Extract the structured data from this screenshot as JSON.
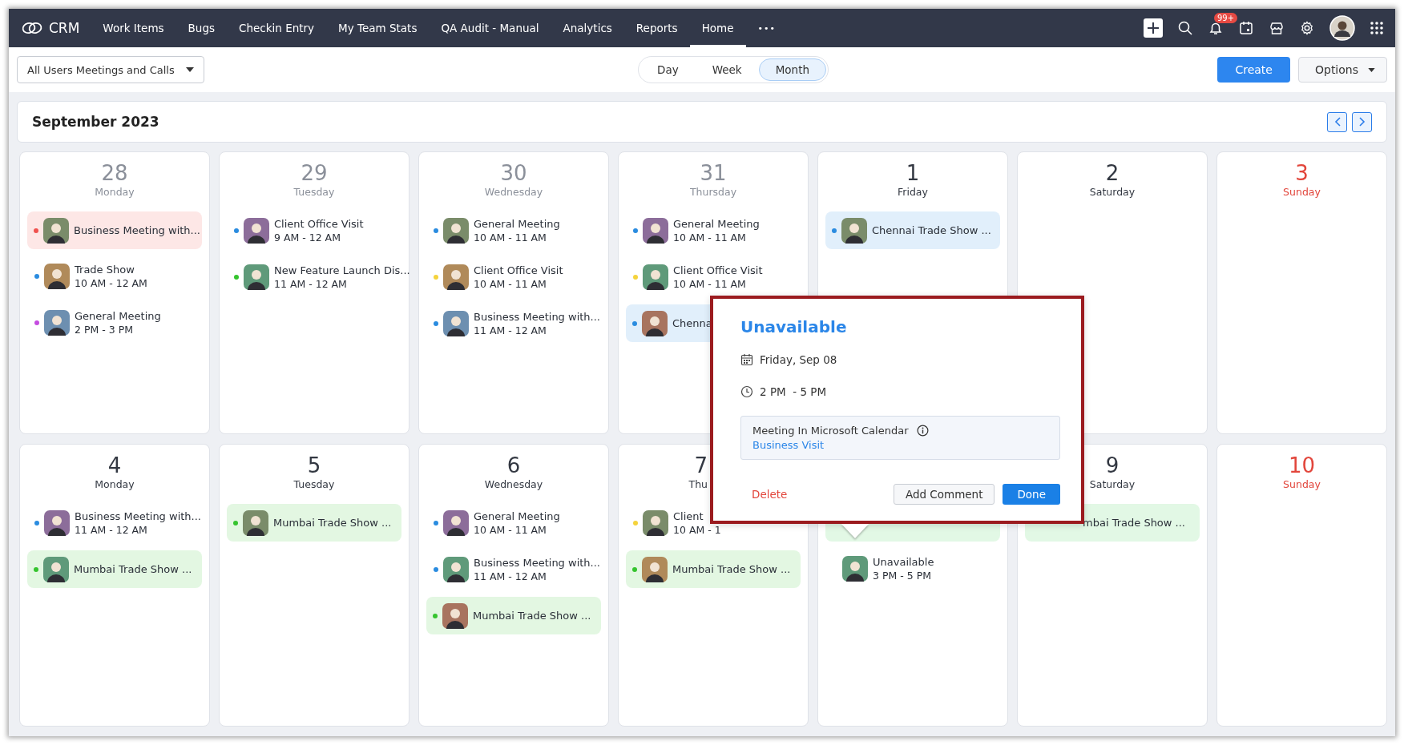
{
  "nav": {
    "brand": "CRM",
    "items": [
      {
        "label": "Work Items",
        "selected": false
      },
      {
        "label": "Bugs",
        "selected": false
      },
      {
        "label": "Checkin Entry",
        "selected": false
      },
      {
        "label": "My Team Stats",
        "selected": false
      },
      {
        "label": "QA Audit - Manual",
        "selected": false
      },
      {
        "label": "Analytics",
        "selected": false
      },
      {
        "label": "Reports",
        "selected": false
      },
      {
        "label": "Home",
        "selected": true
      }
    ],
    "more": "•••",
    "notification_badge": "99+"
  },
  "toolbar": {
    "view_select": "All Users Meetings and Calls",
    "views": [
      {
        "label": "Day",
        "selected": false
      },
      {
        "label": "Week",
        "selected": false
      },
      {
        "label": "Month",
        "selected": true
      }
    ],
    "create": "Create",
    "options": "Options"
  },
  "calendar": {
    "title": "September 2023",
    "days": [
      {
        "number": "28",
        "weekday": "Monday",
        "kind": "past_month",
        "events": [
          {
            "kind": "allday",
            "title": "Business Meeting with...",
            "color": "#f0524f"
          },
          {
            "kind": "timed",
            "title": "Trade Show",
            "time": "10 AM - 12 AM",
            "color": "#2a8ce0"
          },
          {
            "kind": "timed",
            "title": "General Meeting",
            "time": "2 PM - 3 PM",
            "color": "#c54ce0"
          }
        ]
      },
      {
        "number": "29",
        "weekday": "Tuesday",
        "kind": "past_month",
        "events": [
          {
            "kind": "timed",
            "title": "Client Office Visit",
            "time": "9 AM - 12 AM",
            "color": "#2a8ce0"
          },
          {
            "kind": "timed",
            "title": "New Feature Launch Dis...",
            "time": "11 AM - 12 AM",
            "color": "#35c42e"
          }
        ]
      },
      {
        "number": "30",
        "weekday": "Wednesday",
        "kind": "past_month",
        "events": [
          {
            "kind": "timed",
            "title": "General Meeting",
            "time": "10 AM - 11 AM",
            "color": "#2a8ce0"
          },
          {
            "kind": "timed",
            "title": "Client Office Visit",
            "time": "10 AM - 11 AM",
            "color": "#f5d33c"
          },
          {
            "kind": "timed",
            "title": "Business Meeting with...",
            "time": "11 AM - 12 AM",
            "color": "#2a8ce0"
          }
        ]
      },
      {
        "number": "31",
        "weekday": "Thursday",
        "kind": "past_month",
        "events": [
          {
            "kind": "timed",
            "title": "General Meeting",
            "time": "10 AM - 11 AM",
            "color": "#2a8ce0"
          },
          {
            "kind": "timed",
            "title": "Client Office Visit",
            "time": "10 AM - 11 AM",
            "color": "#f5d33c"
          },
          {
            "kind": "allday",
            "title": "Chenna",
            "color": "#2a8ce0"
          }
        ]
      },
      {
        "number": "1",
        "weekday": "Friday",
        "kind": "weekday",
        "events": [
          {
            "kind": "allday",
            "title": "Chennai Trade Show ...",
            "color": "#2a8ce0"
          }
        ]
      },
      {
        "number": "2",
        "weekday": "Saturday",
        "kind": "weekday"
      },
      {
        "number": "3",
        "weekday": "Sunday",
        "kind": "sunday"
      },
      {
        "number": "4",
        "weekday": "Monday",
        "kind": "weekday",
        "events": [
          {
            "kind": "timed",
            "title": "Business Meeting with...",
            "time": "11 AM - 12 AM",
            "color": "#2a8ce0"
          },
          {
            "kind": "allday",
            "title": "Mumbai Trade Show ...",
            "color": "#35c42e"
          }
        ]
      },
      {
        "number": "5",
        "weekday": "Tuesday",
        "kind": "weekday",
        "events": [
          {
            "kind": "allday",
            "title": "Mumbai Trade Show ...",
            "color": "#35c42e"
          }
        ]
      },
      {
        "number": "6",
        "weekday": "Wednesday",
        "kind": "weekday",
        "events": [
          {
            "kind": "timed",
            "title": "General Meeting",
            "time": "10 AM - 11 AM",
            "color": "#2a8ce0"
          },
          {
            "kind": "timed",
            "title": "Business Meeting with...",
            "time": "11 AM - 12 AM",
            "color": "#2a8ce0"
          },
          {
            "kind": "allday",
            "title": "Mumbai Trade Show ...",
            "color": "#35c42e"
          }
        ]
      },
      {
        "number": "7",
        "weekday": "Thu",
        "kind": "cut_right",
        "events": [
          {
            "kind": "timed",
            "title": "Client",
            "time": "10 AM - 1",
            "color": "#f5d33c"
          },
          {
            "kind": "allday",
            "title": "Mumbai Trade Show ...",
            "color": "#35c42e"
          }
        ]
      },
      {
        "events": [
          {
            "kind": "allday_cut",
            "color": "#e2f8e5"
          },
          {
            "kind": "timed",
            "title": "Unavailable",
            "time": "3 PM - 5 PM"
          }
        ]
      },
      {
        "number": "9",
        "weekday": "Saturday",
        "kind": "weekday",
        "events": [
          {
            "kind": "allday_cut",
            "title": "mbai Trade Show ...",
            "color": "#e2f8e5"
          }
        ]
      },
      {
        "number": "10",
        "weekday": "Sunday",
        "kind": "sunday"
      }
    ]
  },
  "popover": {
    "title": "Unavailable",
    "date": "Friday, Sep 08",
    "time": "2 PM  - 5 PM",
    "source": "Meeting In Microsoft Calendar",
    "link": "Business Visit",
    "delete": "Delete",
    "add_comment": "Add Comment",
    "done": "Done"
  }
}
